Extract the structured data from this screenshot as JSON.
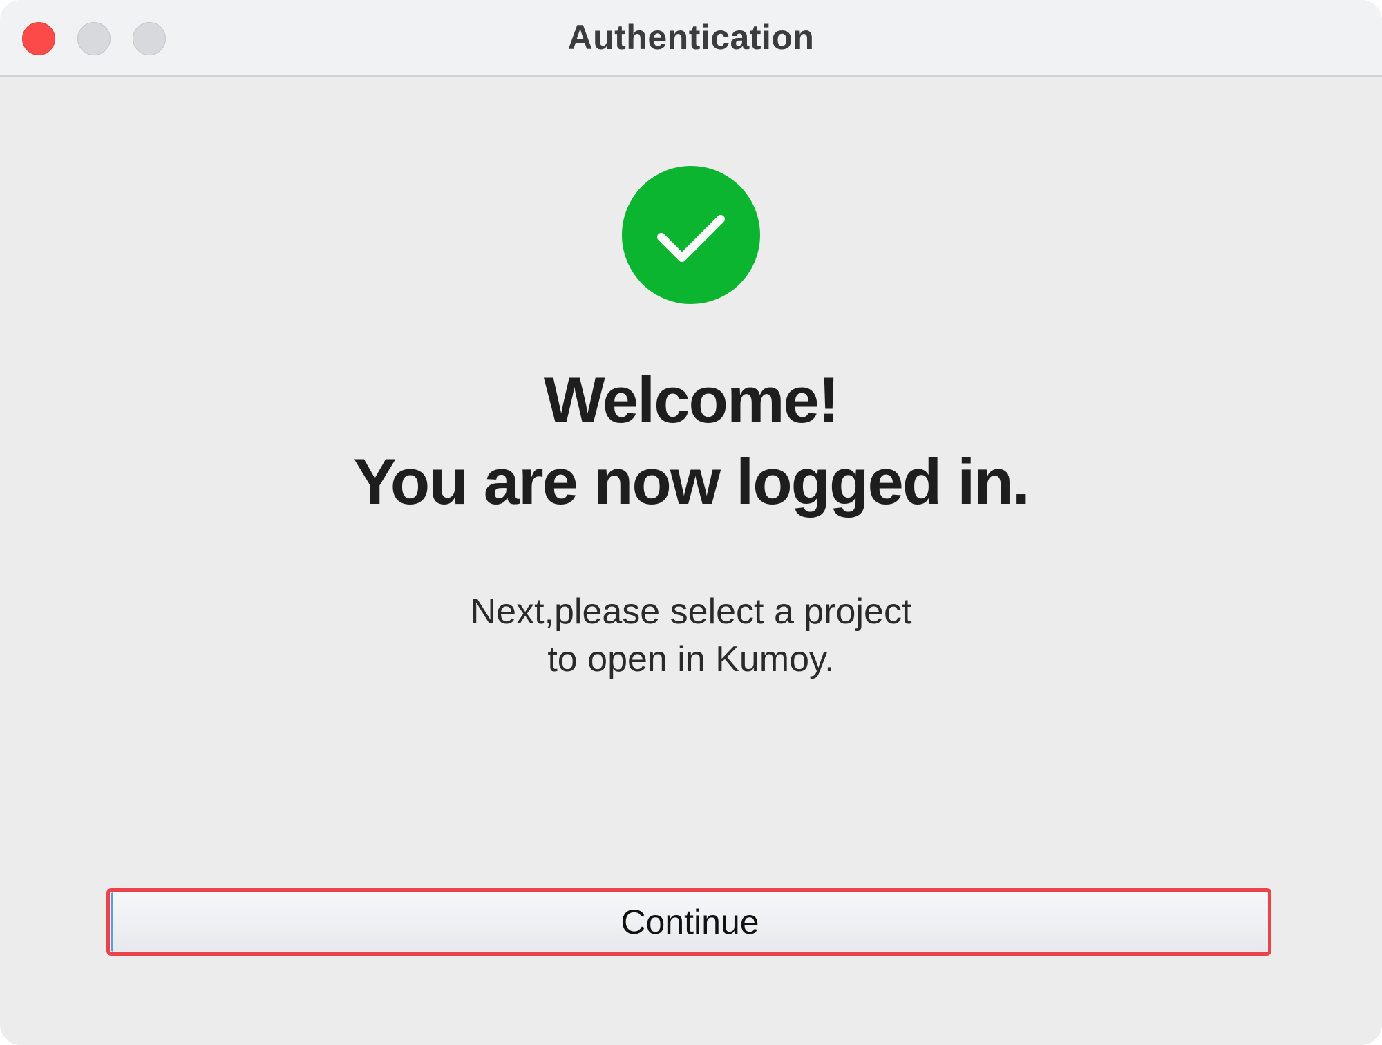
{
  "window": {
    "title": "Authentication",
    "traffic_lights": [
      "close",
      "minimize",
      "maximize"
    ]
  },
  "status": {
    "icon": "checkmark-circle-icon",
    "color": "#0bb530"
  },
  "message": {
    "heading_line1": "Welcome!",
    "heading_line2": "You are now logged in.",
    "body_line1": "Next,please select a project",
    "body_line2": "to open in Kumoy."
  },
  "actions": {
    "continue_label": "Continue",
    "highlight_color": "#e9444b"
  }
}
